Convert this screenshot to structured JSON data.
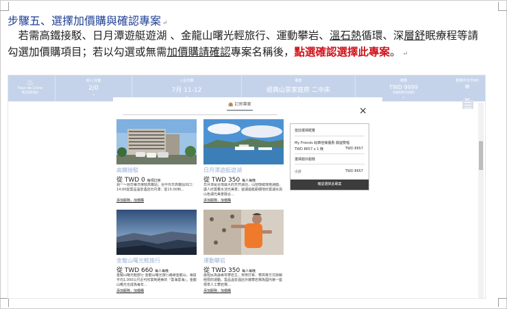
{
  "heading": {
    "text": "步驟五、選擇加價購與確認專案",
    "mark": "↵"
  },
  "paragraph": {
    "p1": "　若需高鐵接駁、日月潭遊艇遊湖 、金龍山曙光輕旅行、運動攀岩、",
    "u1": "溫石熱",
    "p2": "循環、深",
    "u2": "層舒",
    "p3": "眠療程等請勾選加價購項目；若以勾選或無需",
    "u3": "加價購請確認",
    "p4": "專案名稱後，",
    "red": "點選確認選擇此專案",
    "p5": "。",
    "mark": "↵"
  },
  "screenshot": {
    "logo": {
      "mark": "♨",
      "line1": "Fleur de Chine",
      "line2": "雲品溫泉酒店"
    },
    "bar": [
      {
        "label": "成人/兒童",
        "value": "2/0"
      },
      {
        "label": "入住日期",
        "value": "7月 11-12"
      },
      {
        "label": "專案",
        "value": "經典山景家庭房 二中床"
      },
      {
        "label": "總價",
        "value": "TWD 9999",
        "sub": "含服務費及加值稅"
      }
    ],
    "lang_label": "繁體中文/TWD",
    "chev": "⌄",
    "tab_icon": "🏨",
    "tab_label": "訂房專案",
    "close": "×",
    "cards": [
      {
        "title": "高鐵接駁",
        "price": "從 TWD 0",
        "unit": "每項訂房",
        "desc": "週一～週日每日接駁高鐵站；台中烏日高鐵站出口：14:00從雲品溫泉酒店日月潭：從15:00到...",
        "link": "添加服務，加價購"
      },
      {
        "title": "日月潭遊艇遊湖",
        "price": "從 TWD 350",
        "unit": "每人每晚",
        "desc": "日月潭是台灣最大的天然湖泊，山巒環繞環抱湖面，讓人欣賞蓄水池光美景；遊湖遊艇鉅細地欣賞湖水與山色湖光美景融合...",
        "link": "添加服務，加價購"
      },
      {
        "title": "金龍山曙光輕旅行",
        "price": "從 TWD 660",
        "unit": "每人每晚",
        "desc": "金龍山曙光輕旅行 金龍山曙光旅行路線金龍山，海拔平均1,000公尺近可欣賞到絕美的『雲海雲海』，金龍山曙光也成為每年...",
        "link": "添加服務，加價購"
      },
      {
        "title": "運動攀岩",
        "price": "從 TWD 350",
        "unit": "每人每晚",
        "desc": "層班民為讓專攻攀岩主，常用打擊、攀高等方式挑戰極限的運動。雲品溫泉酒店外牆攀岩場為國內第一座標準人工攀岩場...",
        "link": "添加服務，加價購"
      }
    ],
    "side": {
      "title": "當前選擇概覽",
      "item": "My Friends 耘韓佳餚優惠 靜謐雙唱",
      "row1_left": "TWD 8657 x 1 晚",
      "row1_right": "TWD 8657",
      "addon": "選擇額外服務",
      "subtotal_left": "小計",
      "subtotal_right": "TWD 8657",
      "button": "確認選擇此專案"
    }
  }
}
